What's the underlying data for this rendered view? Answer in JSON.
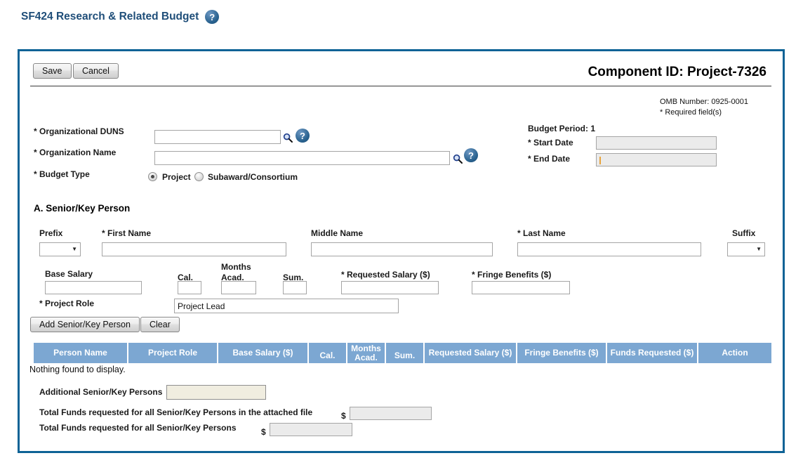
{
  "page_title": "SF424 Research & Related Budget",
  "toolbar": {
    "save": "Save",
    "cancel": "Cancel"
  },
  "header": {
    "component_id": "Component ID: Project-7326",
    "omb_number": "OMB Number: 0925-0001",
    "required_note": "* Required field(s)"
  },
  "org_section": {
    "duns_label": "* Organizational DUNS",
    "duns_value": "",
    "name_label": "* Organization Name",
    "name_value": "",
    "budget_type_label": "* Budget Type",
    "budget_type_options": [
      "Project",
      "Subaward/Consortium"
    ],
    "budget_type_selected": "Project"
  },
  "budget_period": {
    "label": "Budget Period: 1",
    "start_date_label": "* Start Date",
    "start_date_value": "",
    "end_date_label": "* End Date",
    "end_date_value": ""
  },
  "senior_key_person": {
    "heading": "A. Senior/Key Person",
    "prefix_label": "Prefix",
    "first_name_label": "* First Name",
    "middle_name_label": "Middle Name",
    "last_name_label": "* Last Name",
    "suffix_label": "Suffix",
    "base_salary_label": "Base Salary",
    "cal_label": "Cal.",
    "months_label": "Months",
    "acad_label": "Acad.",
    "sum_label": "Sum.",
    "requested_salary_label": "* Requested Salary ($)",
    "fringe_benefits_label": "* Fringe Benefits ($)",
    "project_role_label": "* Project Role",
    "project_role_value": "Project Lead",
    "add_button": "Add Senior/Key Person",
    "clear_button": "Clear"
  },
  "persons_table": {
    "columns": [
      "Person Name",
      "Project Role",
      "Base Salary ($)",
      "Cal.",
      "Months Acad.",
      "Sum.",
      "Requested Salary ($)",
      "Fringe Benefits ($)",
      "Funds Requested ($)",
      "Action"
    ],
    "rows": [],
    "empty_message": "Nothing found to display."
  },
  "totals": {
    "additional_label": "Additional Senior/Key Persons",
    "additional_value": "",
    "attached_file_total_label": "Total Funds requested for all Senior/Key Persons in the attached file",
    "attached_file_total_value": "",
    "all_persons_total_label": "Total Funds requested for all Senior/Key Persons",
    "all_persons_total_value": "",
    "currency_symbol": "$"
  },
  "icons": {
    "help": "help-icon",
    "search": "search-icon",
    "dropdown": "chevron-down-icon"
  },
  "colors": {
    "title_text": "#1F4E79",
    "panel_border": "#0E6396",
    "table_header_bg": "#7CA7D2",
    "table_header_text": "#FFFFFF",
    "readonly_field_bg": "#EBEBEB",
    "additional_field_bg": "#F0EDE0",
    "help_icon_bg": "#28618E",
    "end_date_caret": "#E8A33C"
  }
}
